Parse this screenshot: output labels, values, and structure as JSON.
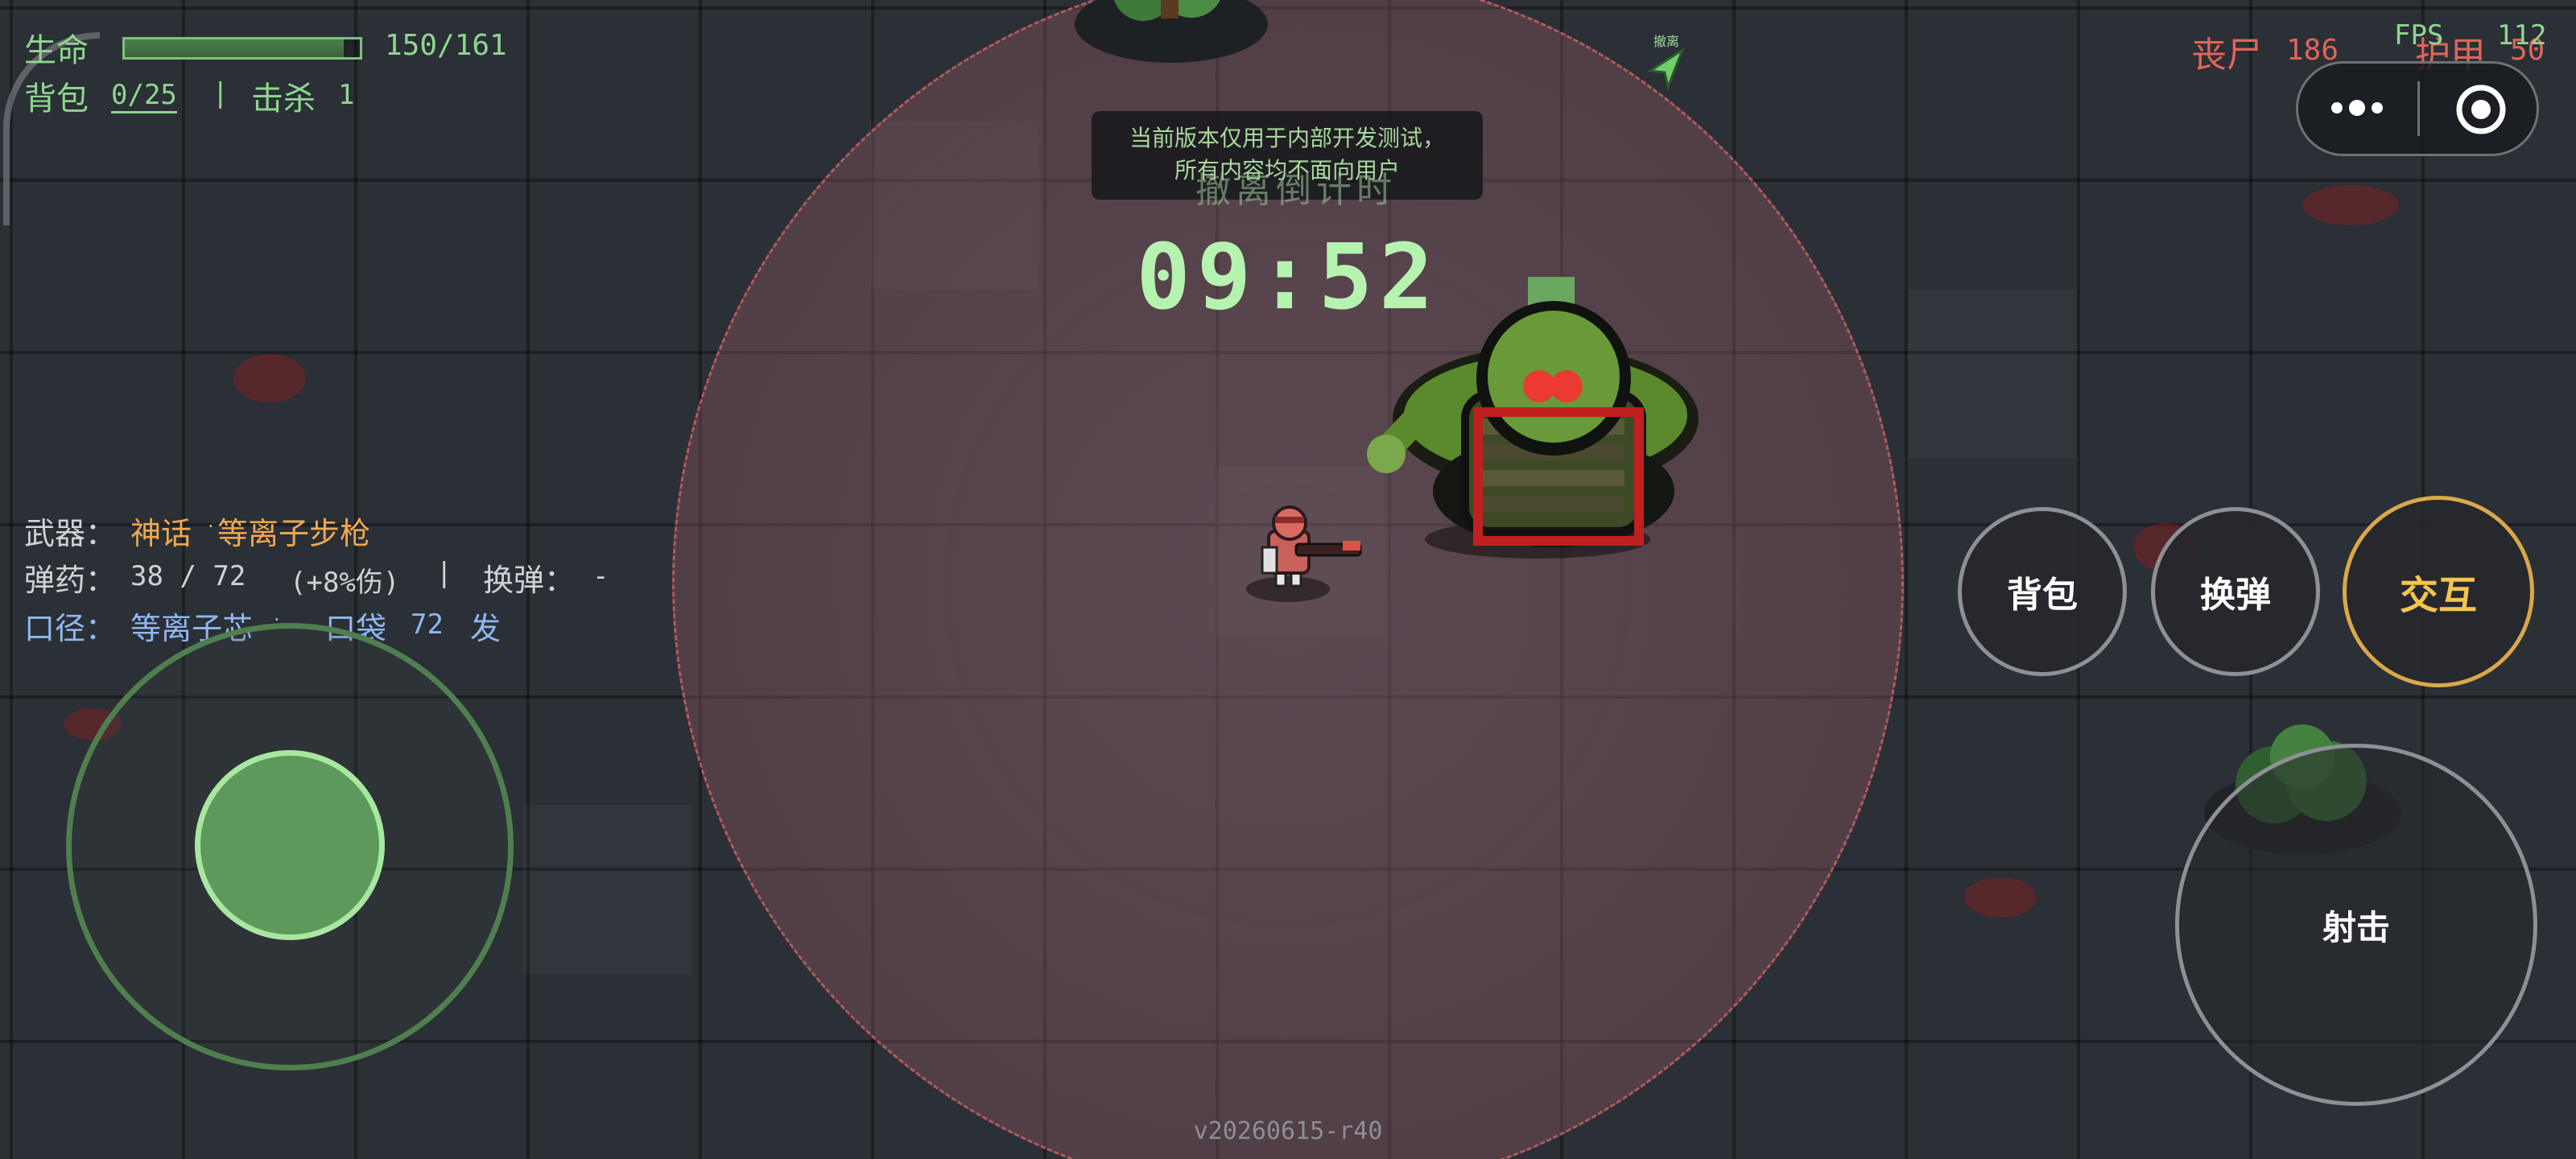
{
  "hud": {
    "hp_label": "生命",
    "hp_value": "150/161",
    "hp_fraction": 0.932,
    "bag_label": "背包",
    "bag_value": "0/25",
    "separator": "|",
    "kills_label": "击杀",
    "kills_value": "1",
    "zombies_label": "丧尸",
    "zombies_value": "186",
    "armor_label": "护甲",
    "armor_value": "50",
    "fps_label": "FPS",
    "fps_value": "112"
  },
  "weapon": {
    "weapon_label": "武器：",
    "weapon_rarity": "神话",
    "weapon_name": "等离子步枪",
    "ammo_label": "弹药：",
    "ammo_value": "38 / 72",
    "ammo_bonus": "(+8%伤)",
    "reload_label": "换弹：",
    "reload_value": "-",
    "caliber_label": "口径：",
    "caliber_value": "等离子芯",
    "pocket_label": "口袋",
    "pocket_value": "72",
    "pocket_unit": "发"
  },
  "notice": {
    "line1": "当前版本仅用于内部开发测试，",
    "line2": "所有内容均不面向用户"
  },
  "evac": {
    "label": "撤离倒计时",
    "time": "09:52",
    "marker_label": "撤离"
  },
  "buttons": {
    "bag": "背包",
    "reload": "换弹",
    "interact": "交互",
    "shoot": "射击"
  },
  "version": "v20260615-r40",
  "colors": {
    "hud_green": "#8fd68f",
    "zombie_red": "#e0645a",
    "weapon_orange": "#f0a850",
    "caliber_blue": "#8fb8f0",
    "interact_gold": "#d9a84a"
  }
}
